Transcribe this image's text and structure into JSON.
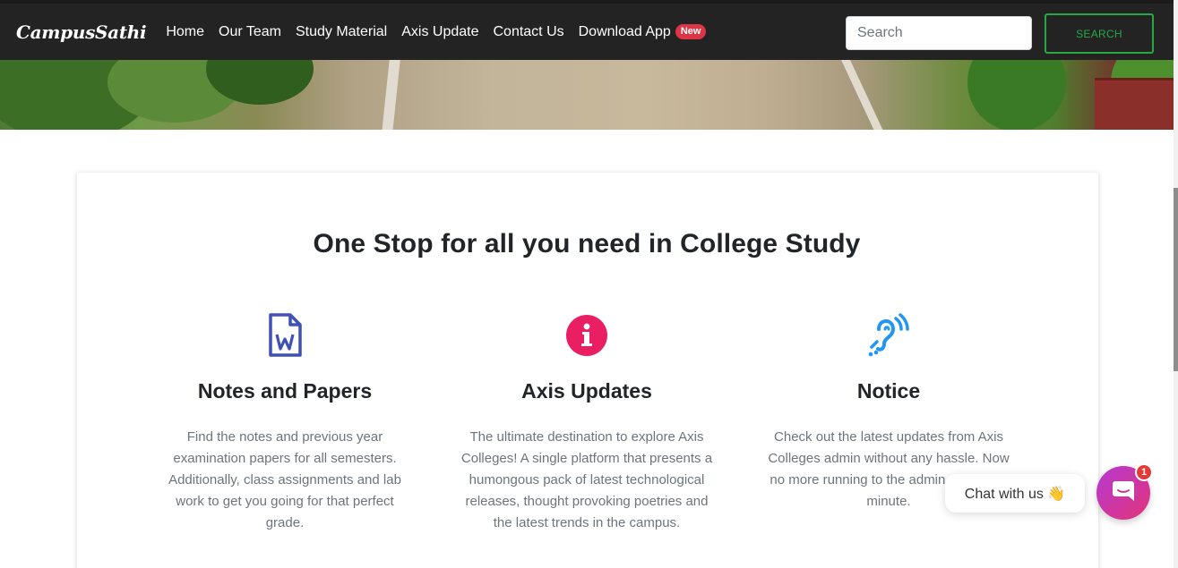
{
  "navbar": {
    "brand": "CampusSathi",
    "links": [
      "Home",
      "Our Team",
      "Study Material",
      "Axis Update",
      "Contact Us",
      "Download App"
    ],
    "badge": "New",
    "search_placeholder": "Search",
    "search_button": "SEARCH"
  },
  "main": {
    "title": "One Stop for all you need in College Study",
    "features": [
      {
        "icon": "word-file-icon",
        "heading": "Notes and Papers",
        "text": "Find the notes and previous year examination papers for all semesters. Additionally, class assignments and lab work to get you going for that perfect grade."
      },
      {
        "icon": "info-circle-icon",
        "heading": "Axis Updates",
        "text": "The ultimate destination to explore Axis Colleges! A single platform that presents a humongous pack of latest technological releases, thought provoking poetries and the latest trends in the campus."
      },
      {
        "icon": "assistive-listening-icon",
        "heading": "Notice",
        "text": "Check out the latest updates from Axis Colleges admin without any hassle. Now no more running to the admin at the last minute."
      }
    ]
  },
  "chat": {
    "bubble_text": "Chat with us 👋",
    "unread_count": "1"
  },
  "colors": {
    "navbar": "#232323",
    "search_accent": "#28a745",
    "badge": "#dc3545",
    "word_icon": "#3f51b5",
    "info_icon": "#e91e63",
    "listening_icon": "#2196f3"
  }
}
